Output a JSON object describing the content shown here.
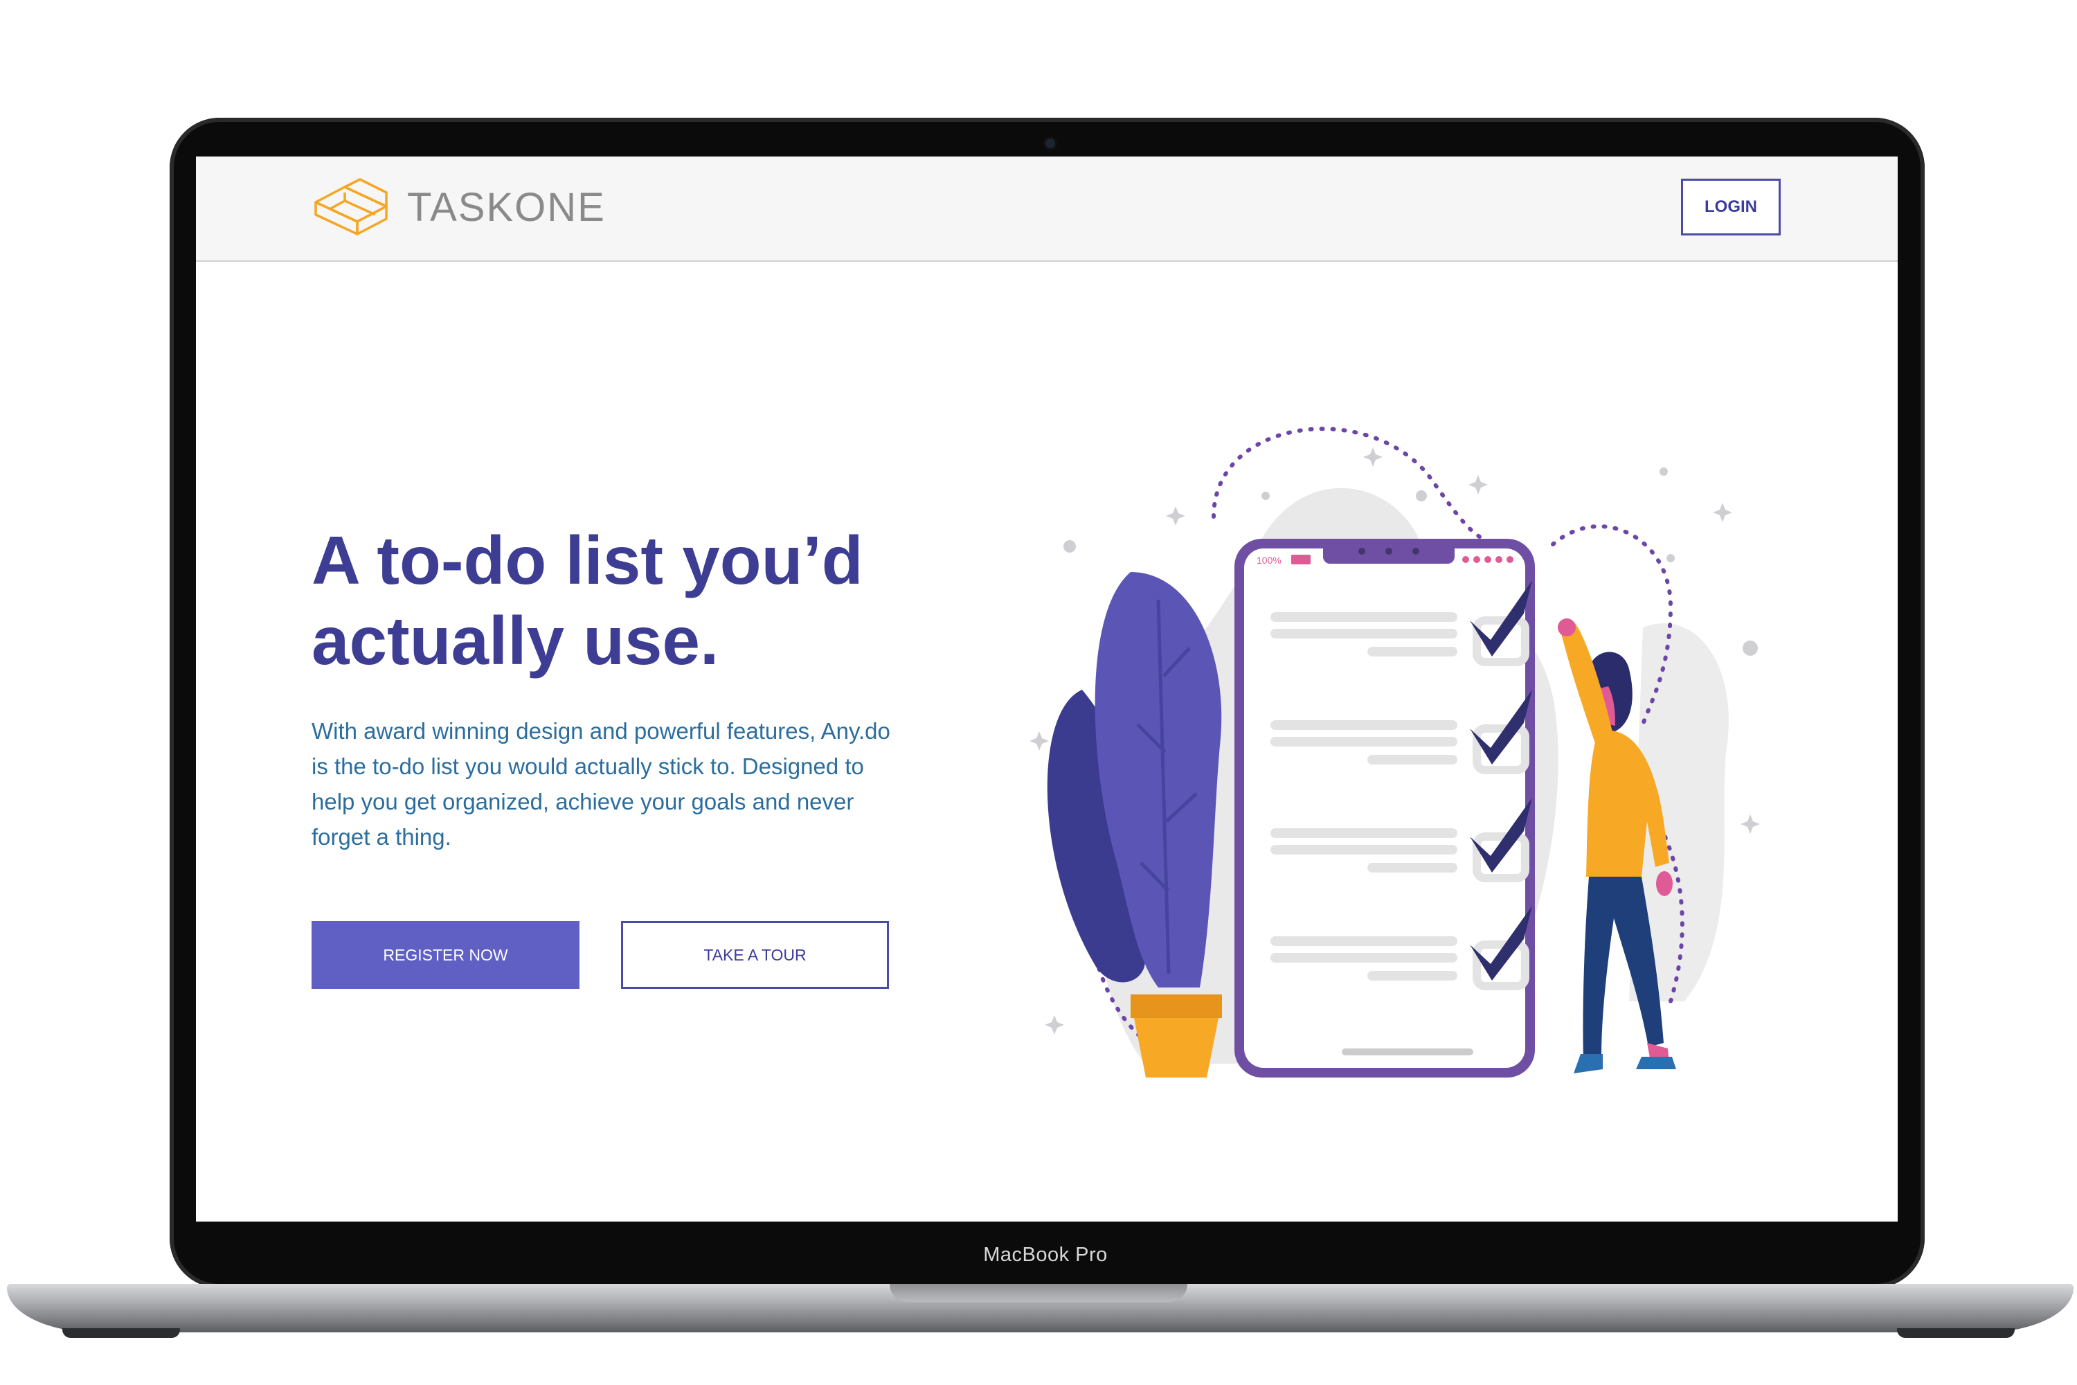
{
  "device": {
    "label": "MacBook Pro"
  },
  "navbar": {
    "brand": "TASKONE",
    "login_label": "LOGIN",
    "logo_icon": "stacked-blocks-logo-icon"
  },
  "hero": {
    "title_line1": "A to-do list you’d",
    "title_line2": "actually use.",
    "description": "With award winning design and powerful features, Any.do is the to-do list you would actually stick to. Designed to help you get organized, achieve your goals and never forget a thing.",
    "register_label": "REGISTER NOW",
    "tour_label": "TAKE A TOUR"
  },
  "illustration": {
    "phone_battery_text": "100%",
    "checklist_items": 4
  },
  "colors": {
    "primary": "#5f5fc4",
    "title": "#3d3d93",
    "body_text": "#2b6e9e",
    "logo": "#f5a623",
    "accent_orange": "#f7a825",
    "phone_frame": "#6e4fa3"
  }
}
